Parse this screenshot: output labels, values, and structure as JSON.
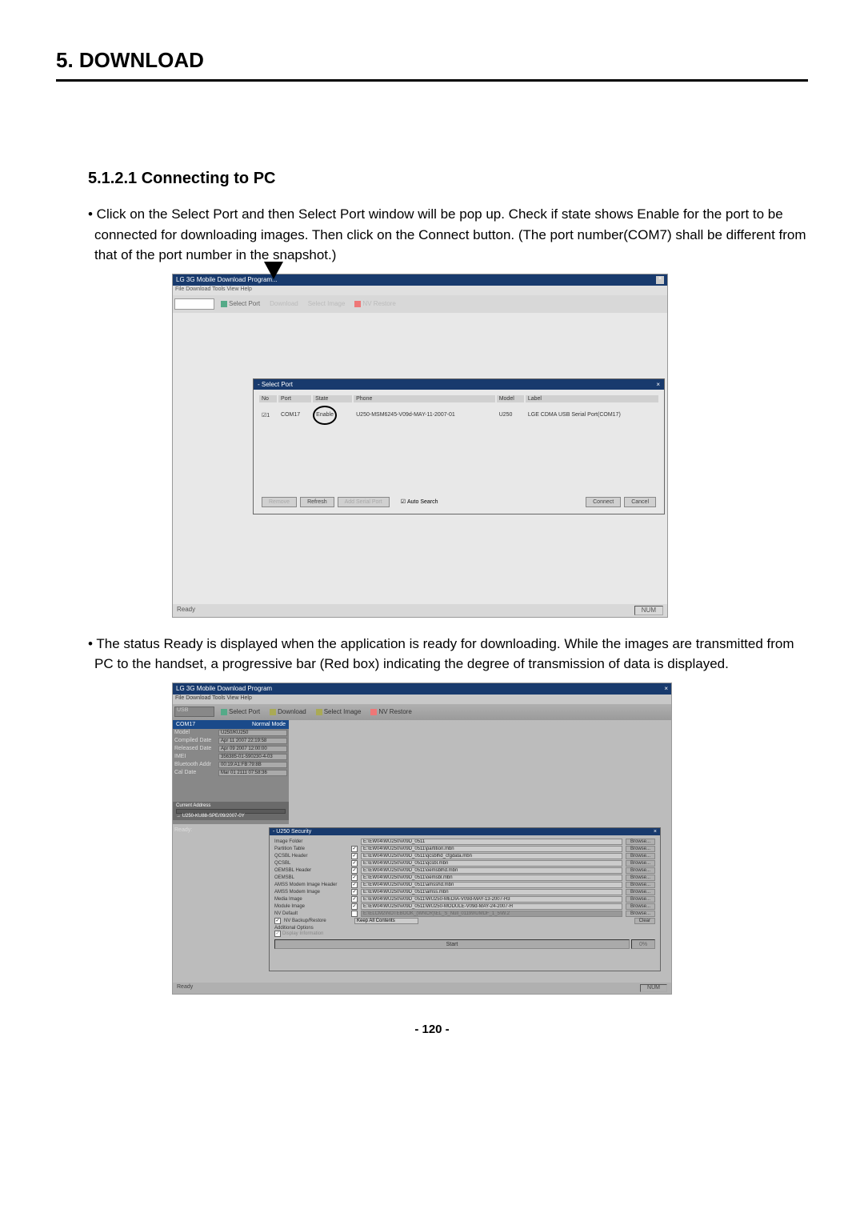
{
  "header": {
    "title": "5. DOWNLOAD"
  },
  "section": {
    "subheading": "5.1.2.1 Connecting to PC",
    "para1_bullet": "•",
    "para1": " Click on the Select Port and then Select Port window will be pop up. Check if state shows Enable for the port to be connected for downloading images. Then click on the Connect button. (The port number(COM7) shall be different from that of the port number in the snapshot.)",
    "para2_bullet": "•",
    "para2": " The status Ready is displayed when the application is ready for downloading. While the images are transmitted from PC to the handset, a progressive bar (Red box) indicating the degree of transmission of data is displayed."
  },
  "screenshot1": {
    "window_title": "LG 3G Mobile Download Program...",
    "close_x": "×",
    "menu": "File  Download  Tools  View  Help",
    "toolbar": {
      "select_port": "Select Port",
      "download": "Download",
      "select_image": "Select Image",
      "nv_restore": "NV Restore"
    },
    "dialog": {
      "title": "- Select Port",
      "headers": {
        "no": "No",
        "port": "Port",
        "state": "State",
        "phone": "Phone",
        "model": "Model",
        "label": "Label"
      },
      "row": {
        "no": "1",
        "port": "COM17",
        "state": "Enable",
        "phone": "U250-MSM6245-V09d-MAY-11-2007-01",
        "model": "U250",
        "label": "LGE CDMA USB Serial Port(COM17)"
      },
      "buttons": {
        "remove": "Remove",
        "refresh": "Refresh",
        "add_serial": "Add Serial Port",
        "auto_search": "Auto Search",
        "connect": "Connect",
        "cancel": "Cancel"
      }
    },
    "status": {
      "ready": "Ready",
      "num": "NUM"
    }
  },
  "screenshot2": {
    "window_title": "LG 3G Mobile Download Program",
    "close_x": "×",
    "menu": "File  Download  Tools  View  Help",
    "toolbar": {
      "port_dropdown": "USB",
      "select_port": "Select Port",
      "download": "Download",
      "select_image": "Select Image",
      "nv_restore": "NV Restore"
    },
    "info_panel": {
      "header_left": "COM17",
      "header_right": "Normal Mode",
      "model_label": "Model",
      "model": "U250/KU250",
      "compiled_label": "Compiled Date",
      "compiled": "Apr 11 2007 22:19:58",
      "released_label": "Released Date",
      "released": "Apr 09 2007 12:00:00",
      "imei_label": "IMEI",
      "imei": "356385-01-590230-4-03",
      "bt_label": "Bluetooth Addr",
      "bt": "00:19:A1:FB:79:8B",
      "cal_label": "Cal Date",
      "cal": "Mar 01 2111 07:58:36"
    },
    "progress": {
      "label": "Current Address",
      "detail": "→ U250-KU88-SPE/09/2007-0Y"
    },
    "ready_left": "Ready:",
    "security_dialog": {
      "title": "- U250 Security",
      "rows": {
        "image_folder": {
          "label": "Image Folder",
          "value": "E:\\EW04\\WU250\\v09D_0511"
        },
        "partition_table": {
          "label": "Partition Table",
          "value": "E:\\EW04\\WU250\\v09D_0511\\partition.mbn"
        },
        "qcsbl_header": {
          "label": "QCSBL Header",
          "value": "E:\\EW04\\WU250\\v09D_0511\\qcsblhd_cfgdata.mbn"
        },
        "qcsbl": {
          "label": "QCSBL",
          "value": "E:\\EW04\\WU250\\v09D_0511\\qcsbl.mbn"
        },
        "oemsbl_header": {
          "label": "OEMSBL Header",
          "value": "E:\\EW04\\WU250\\v09D_0511\\oemsblhd.mbn"
        },
        "oemsbl": {
          "label": "OEMSBL",
          "value": "E:\\EW04\\WU250\\v09D_0511\\oemsbl.mbn"
        },
        "amss_header": {
          "label": "AMSS Modem Image Header",
          "value": "E:\\EW04\\WU250\\v09D_0511\\amsshd.mbn"
        },
        "amss": {
          "label": "AMSS Modem Image",
          "value": "E:\\EW04\\WU250\\v09D_0511\\amss.mbn"
        },
        "media": {
          "label": "Media Image",
          "value": "E:\\EW04\\WU250\\v09D_0511\\WU250-MEDIA-V09d-MAY-13-2007-H3"
        },
        "module": {
          "label": "Module Image",
          "value": "E:\\EW04\\WU250\\v09D_0511\\WU250-MODULE-V09d-MAY-24-2007-H"
        },
        "nv_default": {
          "label": "NV Default",
          "value": "E:\\ELCM2\\NOTEBOOK_(WNCR)\\EL_S_Null_01199\\UMDF_1_5\\W.2"
        }
      },
      "nv_backup_label": "NV Backup/Restore",
      "nv_backup_value": "Keep All Contents",
      "additional": "Additional Options",
      "display_info": "Display Information",
      "browse": "Browse...",
      "clear": "Clear",
      "start": "Start",
      "percent": "0%"
    },
    "status": {
      "ready": "Ready",
      "num": "NUM"
    }
  },
  "page_number": "- 120 -"
}
